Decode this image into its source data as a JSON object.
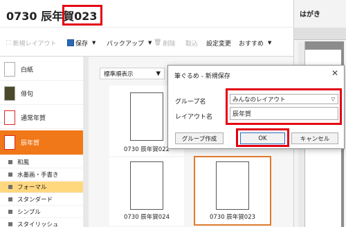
{
  "window": {
    "title": "0730 辰年賀023"
  },
  "toolbar": {
    "new_layout": "新規レイアウト",
    "save": "保存",
    "backup": "バックアップ",
    "delete": "削除",
    "import": "取込",
    "settings": "設定変更",
    "recommend": "おすすめ"
  },
  "right_panel": {
    "title": "はがき"
  },
  "sidebar": {
    "categories": [
      {
        "label": "白紙"
      },
      {
        "label": "俳句"
      },
      {
        "label": "通常年賀"
      },
      {
        "label": "辰年賀"
      }
    ],
    "subitems": [
      {
        "label": "和風"
      },
      {
        "label": "水墨画・手書き"
      },
      {
        "label": "フォーマル"
      },
      {
        "label": "スタンダード"
      },
      {
        "label": "シンプル"
      },
      {
        "label": "スタイリッシュ"
      }
    ]
  },
  "gallery": {
    "sort_label": "標準順表示",
    "items": [
      {
        "caption": "0730 辰年賀022"
      },
      {
        "caption": "0730 辰年賀024"
      },
      {
        "caption": "0730 辰年賀023"
      }
    ]
  },
  "dialog": {
    "title": "筆ぐるめ - 新規保存",
    "group_label": "グループ名",
    "group_value": "みんなのレイアウト",
    "layout_label": "レイアウト名",
    "layout_value": "辰年賀",
    "create_group": "グループ作成",
    "ok": "OK",
    "cancel": "キャンセル"
  },
  "colors": {
    "accent": "#f07818",
    "highlight": "#e30012",
    "selected_sub": "#ffd77f"
  }
}
